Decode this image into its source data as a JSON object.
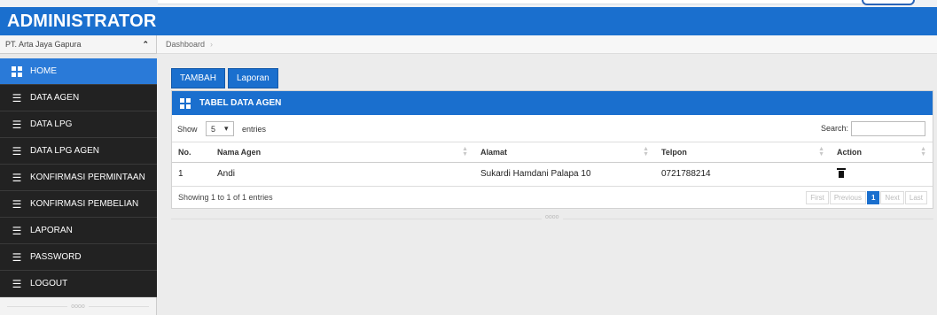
{
  "app": {
    "title": "ADMINISTRATOR"
  },
  "sidebar": {
    "company": "PT. Arta Jaya Gapura",
    "items": [
      {
        "label": "HOME",
        "icon": "grid-icon",
        "active": true
      },
      {
        "label": "DATA AGEN",
        "icon": "list-icon"
      },
      {
        "label": "DATA LPG",
        "icon": "list-icon"
      },
      {
        "label": "DATA LPG AGEN",
        "icon": "list-icon"
      },
      {
        "label": "KONFIRMASI PERMINTAAN",
        "icon": "list-icon"
      },
      {
        "label": "KONFIRMASI PEMBELIAN",
        "icon": "list-icon"
      },
      {
        "label": "LAPORAN",
        "icon": "list-icon"
      },
      {
        "label": "PASSWORD",
        "icon": "list-icon"
      },
      {
        "label": "LOGOUT",
        "icon": "list-icon"
      }
    ],
    "footer": "oooo"
  },
  "breadcrumb": {
    "label": "Dashboard"
  },
  "toolbar": {
    "tambah": "TAMBAH",
    "laporan": "Laporan"
  },
  "panel": {
    "title": "TABEL DATA AGEN",
    "show_label": "Show",
    "entries_value": "5",
    "entries_label": "entries",
    "search_label": "Search:",
    "columns": [
      "No.",
      "Nama Agen",
      "Alamat",
      "Telpon",
      "Action"
    ],
    "rows": [
      {
        "no": "1",
        "nama": "Andi",
        "alamat": "Sukardi Hamdani Palapa 10",
        "telpon": "0721788214"
      }
    ],
    "info": "Showing 1 to 1 of 1 entries",
    "pager": {
      "first": "First",
      "previous": "Previous",
      "current": "1",
      "next": "Next",
      "last": "Last"
    }
  },
  "divider": "oooo",
  "colors": {
    "accent": "#1a6fce",
    "sidebar_bg": "#222222",
    "active_item": "#2a7ad8"
  }
}
